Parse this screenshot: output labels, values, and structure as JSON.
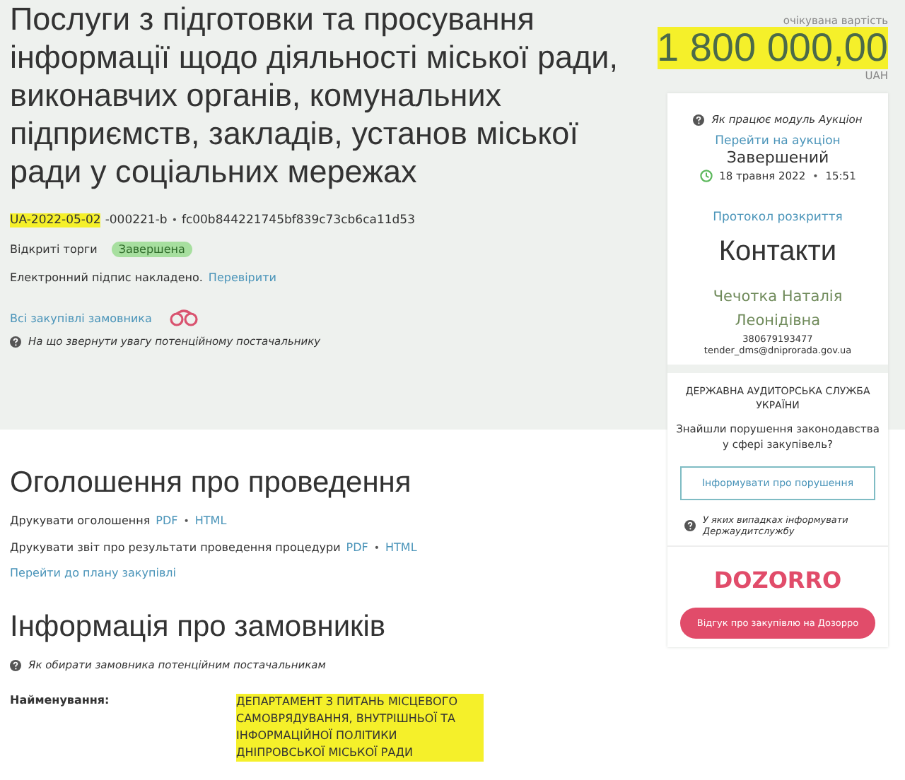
{
  "tender": {
    "title": "Послуги з підготовки та просування інформації щодо діяльності міської ради, виконавчих органів, комунальних підприємств, закладів, установ міської ради у соціальних мережах",
    "id_parts": [
      {
        "text": "UA-2022-05-02",
        "highlighted": true
      },
      {
        "text": "-000221-b",
        "highlighted": false
      }
    ],
    "separator": "•",
    "hash": "fc00b844221745bf839c73cb6ca11d53",
    "procedure": "Відкриті торги",
    "status": "Завершена",
    "signature": "Електронний підпис накладено.",
    "verify_link": "Перевірити",
    "buyer_link": "Всі закупівлі замовника",
    "hint": "На що звернути увагу потенційному постачальнику"
  },
  "value": {
    "label": "очікувана вартість",
    "amount": "1 800 000,00",
    "highlighted": true,
    "currency": "UAH"
  },
  "auction": {
    "hint": "Як працює модуль Аукціон",
    "link": "Перейти на аукціон",
    "status": "Завершений",
    "date": "18 травня 2022",
    "separator": "•",
    "time": "15:51",
    "protocol_link": "Протокол розкриття"
  },
  "contacts": {
    "heading": "Контакти",
    "name": "Чечотка Наталія Леонідівна",
    "phone": "380679193477",
    "email": "tender_dms@dniprorada.gov.ua"
  },
  "audit": {
    "heading": "ДЕРЖАВНА АУДИТОРСЬКА СЛУЖБА УКРАЇНИ",
    "question": "Знайшли порушення законодавства у сфері закупівель?",
    "button": "Інформувати про порушення",
    "hint": "У яких випадках інформувати Держаудитслужбу"
  },
  "dozorro": {
    "logo": "DOZORRO",
    "button": "Відгук про закупівлю на Дозорро"
  },
  "announcement": {
    "heading": "Оголошення про проведення",
    "prints": [
      {
        "label": "Друкувати оголошення",
        "links": [
          "PDF",
          "HTML"
        ],
        "separator": "•"
      },
      {
        "label": "Друкувати звіт про результати проведення процедури",
        "links": [
          "PDF",
          "HTML"
        ],
        "separator": "•"
      }
    ],
    "plan_link": "Перейти до плану закупівлі"
  },
  "buyer": {
    "heading": "Інформація про замовників",
    "hint": "Як обирати замовника потенційним постачальникам",
    "fields": [
      {
        "label": "Найменування:",
        "value": "ДЕПАРТАМЕНТ З ПИТАНЬ МІСЦЕВОГО САМОВРЯДУВАННЯ, ВНУТРІШНЬОЇ ТА ІНФОРМАЦІЙНОЇ ПОЛІТИКИ ДНІПРОВСЬКОЇ МІСЬКОЇ РАДИ",
        "highlighted": true
      }
    ]
  }
}
